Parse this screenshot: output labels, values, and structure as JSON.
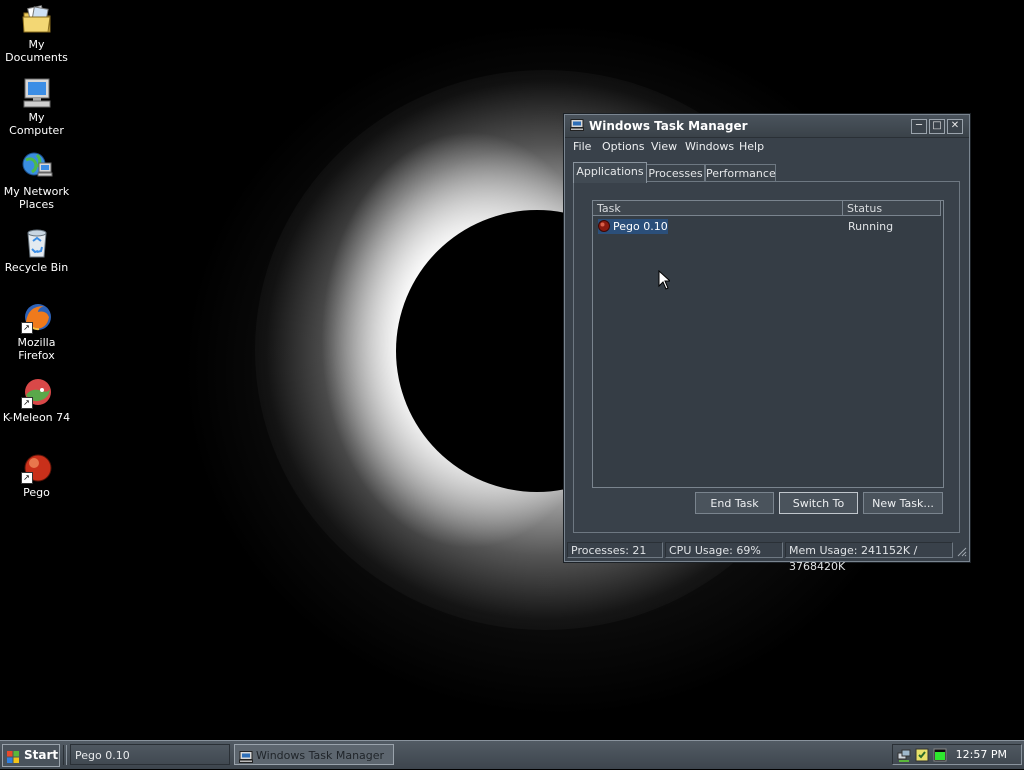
{
  "desktop": {
    "icons": [
      {
        "label": "My Documents",
        "icon": "folder-documents-icon"
      },
      {
        "label": "My Computer",
        "icon": "computer-icon"
      },
      {
        "label_line1": "My Network",
        "label_line2": "Places",
        "icon": "network-places-icon"
      },
      {
        "label": "Recycle Bin",
        "icon": "recycle-bin-icon"
      },
      {
        "label": "Mozilla Firefox",
        "icon": "firefox-icon"
      },
      {
        "label": "K-Meleon 74",
        "icon": "k-meleon-icon"
      },
      {
        "label": "Pego",
        "icon": "pego-icon"
      }
    ]
  },
  "window": {
    "title": "Windows Task Manager",
    "menu": [
      "File",
      "Options",
      "View",
      "Windows",
      "Help"
    ],
    "tabs": [
      "Applications",
      "Processes",
      "Performance"
    ],
    "active_tab": "Applications",
    "columns": [
      "Task",
      "Status"
    ],
    "rows": [
      {
        "task": "Pego 0.10",
        "status": "Running"
      }
    ],
    "buttons": {
      "end_task": "End Task",
      "switch_to": "Switch To",
      "new_task": "New Task..."
    },
    "status": {
      "processes": "Processes: 21",
      "cpu": "CPU Usage: 69%",
      "mem": "Mem Usage: 241152K / 3768420K"
    }
  },
  "taskbar": {
    "start": "Start",
    "items": [
      "Pego 0.10",
      "Windows Task Manager"
    ],
    "clock": "12:57 PM"
  },
  "colors": {
    "window_bg": "#39414a",
    "selection": "#2b4f7a"
  }
}
